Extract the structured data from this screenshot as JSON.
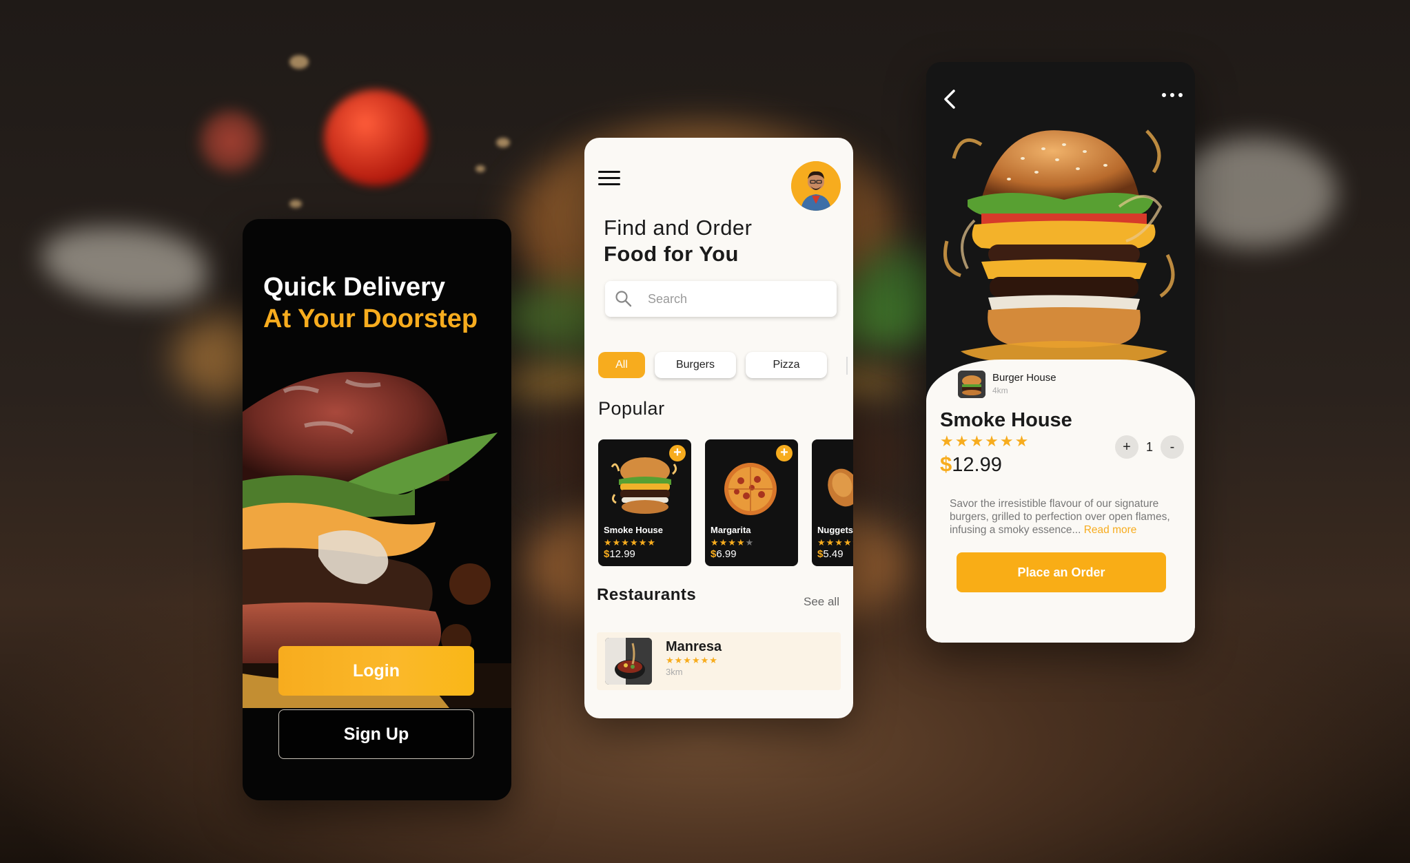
{
  "login_screen": {
    "title_line1": "Quick Delivery",
    "title_line2": "At Your Doorstep",
    "login_label": "Login",
    "signup_label": "Sign Up"
  },
  "home_screen": {
    "title_line1": "Find and Order",
    "title_line2": "Food for You",
    "search_placeholder": "Search",
    "categories": [
      {
        "label": "All",
        "active": true
      },
      {
        "label": "Burgers",
        "active": false
      },
      {
        "label": "Pizza",
        "active": false
      }
    ],
    "popular_title": "Popular",
    "popular_items": [
      {
        "name": "Smoke House",
        "rating": 6,
        "currency": "$",
        "price": "12.99",
        "add": "+"
      },
      {
        "name": "Margarita",
        "rating": 4,
        "currency": "$",
        "price": "6.99",
        "add": "+"
      },
      {
        "name": "Nuggets",
        "rating": 3,
        "currency": "$",
        "price": "5.49",
        "add": "+"
      }
    ],
    "restaurants_title": "Restaurants",
    "see_all_label": "See all",
    "restaurants": [
      {
        "name": "Manresa",
        "rating": 6,
        "distance": "3km"
      }
    ]
  },
  "detail_screen": {
    "shop_name": "Burger House",
    "shop_distance": "4km",
    "dish_name": "Smoke House",
    "rating": 6,
    "currency": "$",
    "price": "12.99",
    "increment_label": "+",
    "quantity": "1",
    "decrement_label": "-",
    "description": "Savor the irresistible flavour of our signature burgers, grilled to perfection over open flames, infusing a smoky essence...",
    "read_more_label": "Read more",
    "order_label": "Place an Order"
  },
  "colors": {
    "accent": "#f7ac1e",
    "dark": "#050505",
    "light_surface": "#fbf9f5"
  }
}
